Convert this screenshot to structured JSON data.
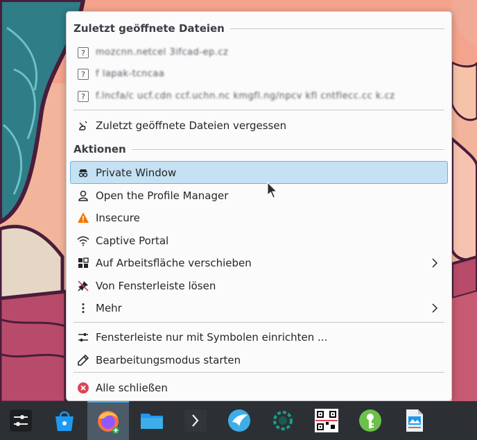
{
  "menu": {
    "recent_header": "Zuletzt geöffnete Dateien",
    "recent_files": [
      "mozcnn.netcel 3ifcad-ep.cz",
      "f lapak-tcncaa",
      "f.lncfa/c ucf.cdn ccf.uchn.nc kmgfl.ng/npcv kfl cntflecc.cc k.cz"
    ],
    "forget_label": "Zuletzt geöffnete Dateien vergessen",
    "actions_header": "Aktionen",
    "actions": [
      {
        "label": "Private Window",
        "icon": "incognito-icon"
      },
      {
        "label": "Open the Profile Manager",
        "icon": "user-icon"
      },
      {
        "label": "Insecure",
        "icon": "warning-icon"
      },
      {
        "label": "Captive Portal",
        "icon": "wifi-icon"
      },
      {
        "label": "Auf Arbeitsfläche verschieben",
        "icon": "desktop-move-icon"
      },
      {
        "label": "Von Fensterleiste lösen",
        "icon": "unpin-icon"
      },
      {
        "label": "Mehr",
        "icon": "more-icon"
      }
    ],
    "configure_label": "Fensterleiste nur mit Symbolen einrichten ...",
    "edit_mode_label": "Bearbeitungsmodus starten",
    "close_all_label": "Alle schließen"
  },
  "colors": {
    "highlight": "#c5e1f3",
    "highlight_border": "#6cb1e3",
    "accent": "#3daee9",
    "close_red": "#da4453",
    "warning": "#f67400"
  },
  "taskbar": {
    "apps": [
      {
        "name": "app-launcher-icon"
      },
      {
        "name": "discover-icon"
      },
      {
        "name": "firefox-icon",
        "active": true
      },
      {
        "name": "dolphin-icon"
      },
      {
        "name": "terminal-icon"
      },
      {
        "name": "bird-app-icon"
      },
      {
        "name": "teal-ring-icon"
      },
      {
        "name": "qr-scanner-icon"
      },
      {
        "name": "keepass-icon"
      },
      {
        "name": "writer-icon"
      }
    ]
  }
}
